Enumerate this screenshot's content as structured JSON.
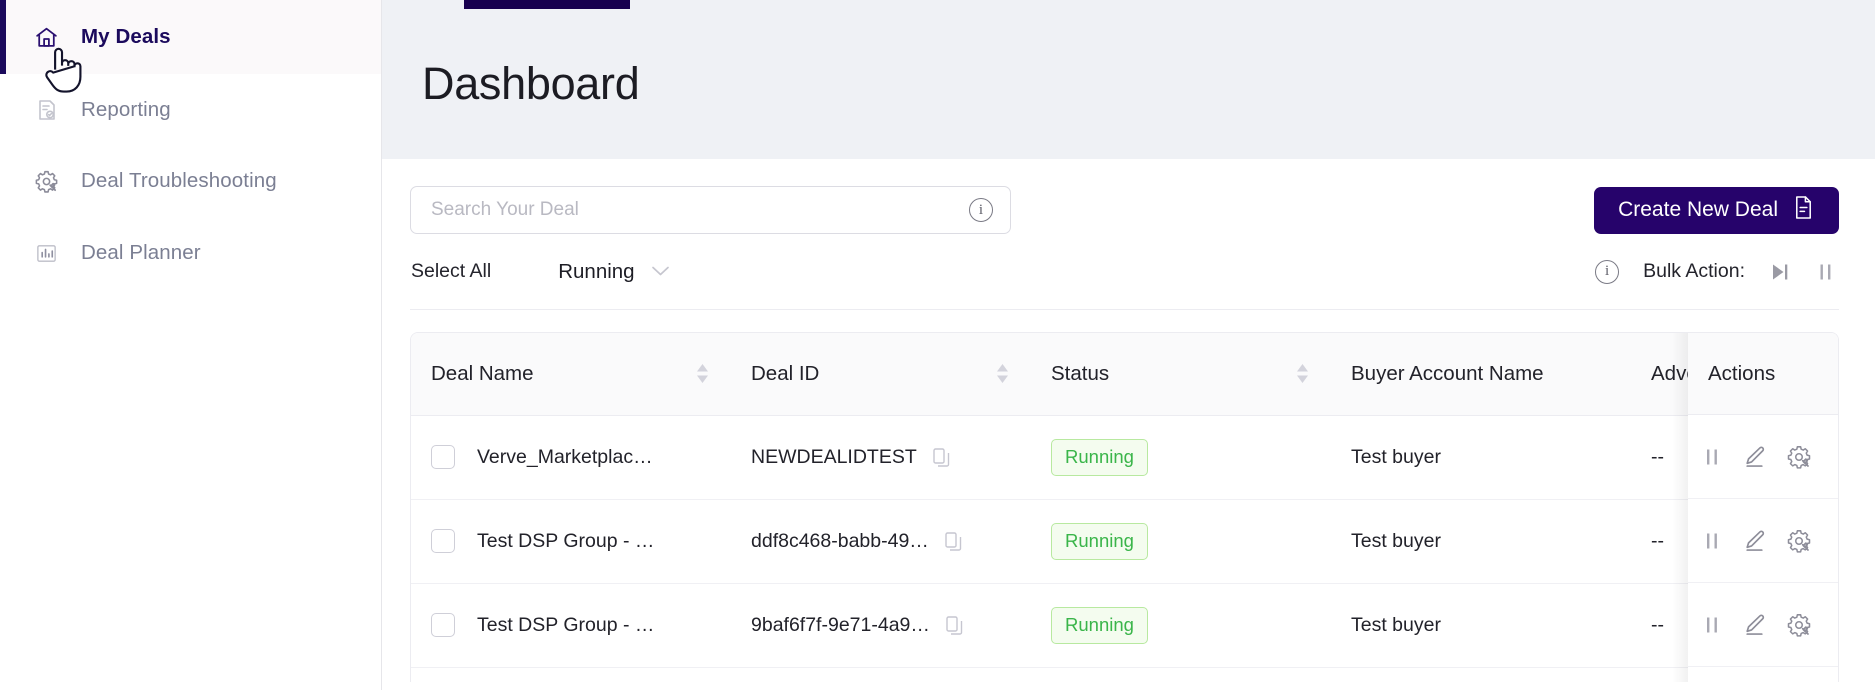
{
  "sidebar": {
    "items": [
      {
        "label": "My Deals",
        "icon": "home-icon",
        "active": true
      },
      {
        "label": "Reporting",
        "icon": "report-icon",
        "active": false
      },
      {
        "label": "Deal Troubleshooting",
        "icon": "gear-wrench-icon",
        "active": false
      },
      {
        "label": "Deal Planner",
        "icon": "bar-chart-icon",
        "active": false
      }
    ]
  },
  "header": {
    "title": "Dashboard"
  },
  "search": {
    "placeholder": "Search Your Deal",
    "value": "",
    "info_icon": "info-icon"
  },
  "toolbar": {
    "create_label": "Create New Deal",
    "create_icon": "document-icon",
    "select_all_label": "Select All",
    "status_filter_value": "Running",
    "status_filter_icon": "chevron-down-icon",
    "bulk_action_label": "Bulk Action:",
    "bulk_info_icon": "info-icon",
    "bulk_resume_icon": "skip-forward-icon",
    "bulk_pause_icon": "pause-icon"
  },
  "table": {
    "columns": [
      {
        "key": "deal_name",
        "label": "Deal Name",
        "sortable": true
      },
      {
        "key": "deal_id",
        "label": "Deal ID",
        "sortable": true
      },
      {
        "key": "status",
        "label": "Status",
        "sortable": true
      },
      {
        "key": "buyer",
        "label": "Buyer Account Name",
        "sortable": false
      },
      {
        "key": "advertiser",
        "label": "Advertis",
        "sortable": false
      },
      {
        "key": "actions",
        "label": "Actions",
        "sortable": false
      }
    ],
    "rows": [
      {
        "deal_name": "Verve_Marketplac…",
        "deal_id": "NEWDEALIDTEST",
        "status": "Running",
        "buyer": "Test buyer",
        "advertiser": "--"
      },
      {
        "deal_name": "Test DSP Group - …",
        "deal_id": "ddf8c468-babb-49…",
        "status": "Running",
        "buyer": "Test buyer",
        "advertiser": "--"
      },
      {
        "deal_name": "Test DSP Group - …",
        "deal_id": "9baf6f7f-9e71-4a9…",
        "status": "Running",
        "buyer": "Test buyer",
        "advertiser": "--"
      }
    ],
    "row_action_icons": [
      "pause-icon",
      "edit-pencil-icon",
      "gear-wrench-icon"
    ],
    "copy_icon": "copy-icon",
    "row_checkbox": "row-checkbox"
  },
  "colors": {
    "brand_navy": "#26036b",
    "sidebar_active_accent": "#1b0a5c",
    "header_bg": "#eff1f5",
    "status_running": "#3ab54a",
    "status_running_bg": "#f4fcef"
  }
}
